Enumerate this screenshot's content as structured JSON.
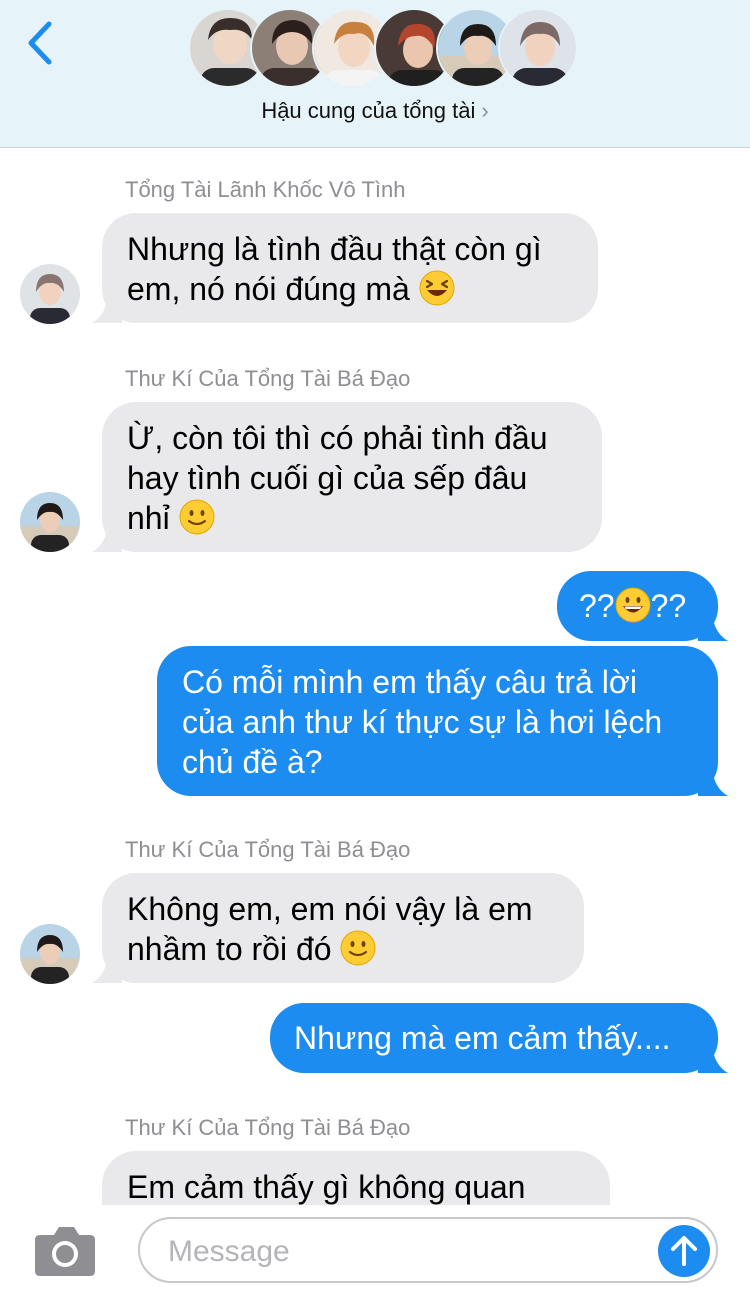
{
  "header": {
    "group_name": "Hậu cung của tổng tài",
    "chevron": "›",
    "back_icon": "chevron-left-icon",
    "member_count_shown": 6
  },
  "messages": [
    {
      "direction": "incoming",
      "sender": "Tổng Tài Lãnh Khốc Vô Tình",
      "lines": [
        "Nhưng là tình đầu thật còn gì",
        "em, nó nói đúng mà"
      ],
      "emoji": "laughing-face"
    },
    {
      "direction": "incoming",
      "sender": "Thư Kí Của Tổng Tài Bá Đạo",
      "lines": [
        "Ừ, còn tôi thì có phải tình đầu",
        "hay tình cuối gì của sếp đâu",
        "nhỉ"
      ],
      "emoji": "slight-smile"
    },
    {
      "direction": "outgoing",
      "pre": "??",
      "emoji": "grinning-face",
      "post": "??"
    },
    {
      "direction": "outgoing",
      "lines": [
        "Có mỗi mình em thấy câu trả lời",
        "của anh thư kí thực sự là hơi lệch",
        "chủ đề à?"
      ]
    },
    {
      "direction": "incoming",
      "sender": "Thư Kí Của Tổng Tài Bá Đạo",
      "lines": [
        "Không em, em nói vậy là em",
        "nhầm to rồi đó"
      ],
      "emoji": "slight-smile"
    },
    {
      "direction": "outgoing",
      "lines": [
        "Nhưng mà em cảm thấy...."
      ]
    },
    {
      "direction": "incoming",
      "sender": "Thư Kí Của Tổng Tài Bá Đạo",
      "lines": [
        "Em cảm thấy gì không quan"
      ]
    }
  ],
  "input": {
    "placeholder": "Message",
    "camera_icon": "camera-icon",
    "send_icon": "arrow-up-icon"
  },
  "colors": {
    "header_bg": "#e6f3f9",
    "incoming_bubble": "#e9e9eb",
    "outgoing_bubble": "#1d8cf0",
    "accent": "#1d8cf0",
    "name_gray": "#8e8e93"
  }
}
